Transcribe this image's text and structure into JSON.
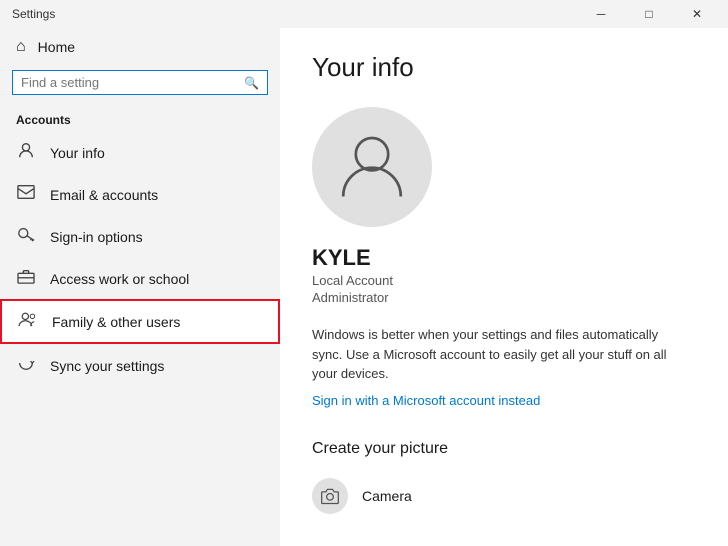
{
  "titlebar": {
    "title": "Settings",
    "minimize_label": "─",
    "restore_label": "□",
    "close_label": "✕"
  },
  "sidebar": {
    "home_label": "Home",
    "search_placeholder": "Find a setting",
    "section_label": "Accounts",
    "nav_items": [
      {
        "id": "your-info",
        "label": "Your info",
        "icon": "person"
      },
      {
        "id": "email-accounts",
        "label": "Email & accounts",
        "icon": "email"
      },
      {
        "id": "sign-in-options",
        "label": "Sign-in options",
        "icon": "key"
      },
      {
        "id": "access-work",
        "label": "Access work or school",
        "icon": "briefcase"
      },
      {
        "id": "family-users",
        "label": "Family & other users",
        "icon": "people",
        "highlighted": true
      },
      {
        "id": "sync-settings",
        "label": "Sync your settings",
        "icon": "sync"
      }
    ]
  },
  "main": {
    "page_title": "Your info",
    "user_name": "KYLE",
    "user_role": "Local Account",
    "user_type": "Administrator",
    "info_text": "Windows is better when your settings and files automatically sync. Use a Microsoft account to easily get all your stuff on all your devices.",
    "link_text": "Sign in with a Microsoft account instead",
    "section_create_picture": "Create your picture",
    "camera_label": "Camera"
  }
}
